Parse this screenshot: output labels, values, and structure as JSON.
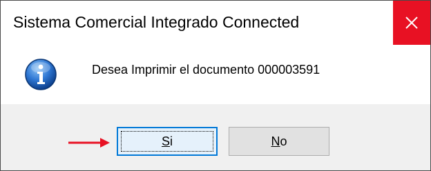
{
  "window": {
    "title": "Sistema Comercial Integrado Connected",
    "close_glyph": "✕"
  },
  "dialog": {
    "icon": "info-icon",
    "message": "Desea Imprimir el documento 000003591"
  },
  "buttons": {
    "yes": {
      "mnemonic": "S",
      "rest": "i"
    },
    "no": {
      "mnemonic": "N",
      "rest": "o"
    }
  },
  "colors": {
    "close_bg": "#e81123",
    "footer_bg": "#f0f0f0",
    "arrow": "#e81123",
    "info_icon": "#1a5fb4"
  }
}
